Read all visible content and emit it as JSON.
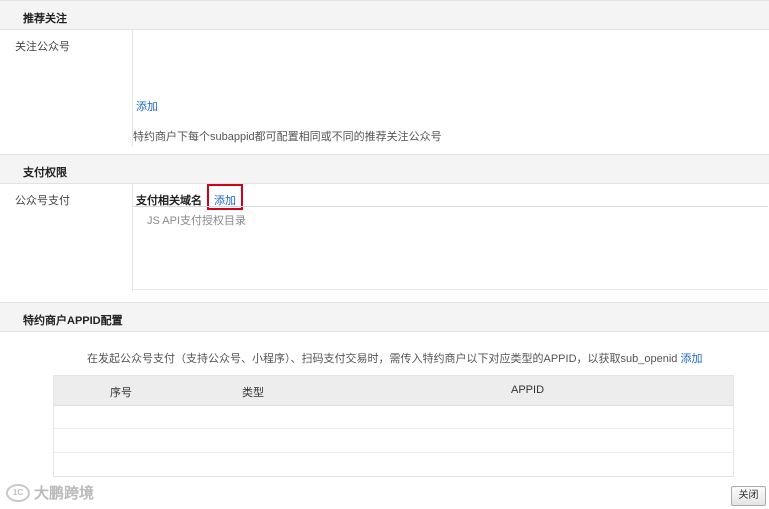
{
  "sections": {
    "recommend": {
      "title": "推荐关注"
    },
    "payment": {
      "title": "支付权限"
    },
    "appid": {
      "title": "特约商户APPID配置"
    }
  },
  "recommend": {
    "label": "关注公众号",
    "add_link": "添加",
    "hint": "特约商户下每个subappid都可配置相同或不同的推荐关注公众号"
  },
  "payment": {
    "label": "公众号支付",
    "domain_title": "支付相关域名",
    "add_link": "添加",
    "jsapi_placeholder": "JS API支付授权目录"
  },
  "appid": {
    "desc": "在发起公众号支付（支持公众号、小程序）、扫码支付交易时，需传入特约商户以下对应类型的APPID，以获取sub_openid",
    "add_link": "添加",
    "columns": [
      "序号",
      "类型",
      "APPID"
    ]
  },
  "footer": {
    "close_label": "关闭",
    "watermark_text": "大鹏跨境"
  },
  "colors": {
    "link": "#1a66c4",
    "highlight_border": "#d0021b"
  }
}
